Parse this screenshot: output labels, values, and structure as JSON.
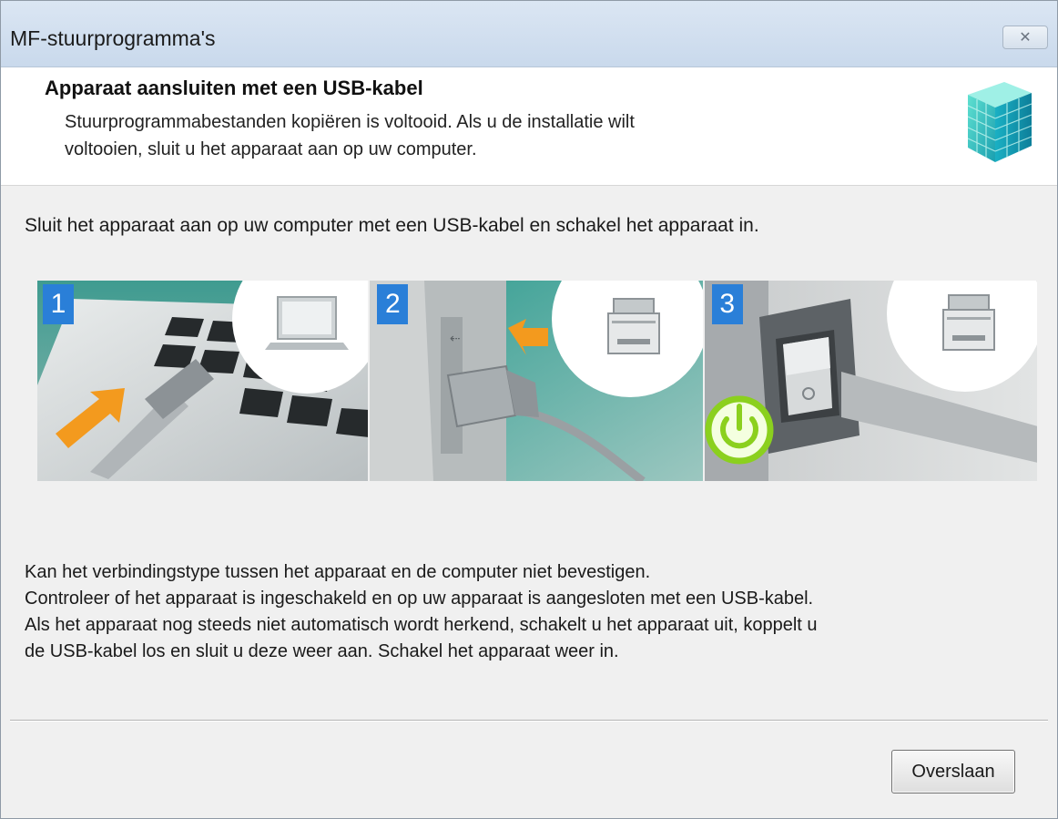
{
  "window": {
    "title": "MF-stuurprogramma's",
    "close_glyph": "✕"
  },
  "header": {
    "title": "Apparaat aansluiten met een USB-kabel",
    "description_line1": "Stuurprogrammabestanden kopiëren is voltooid. Als u de installatie wilt",
    "description_line2": "voltooien, sluit u het apparaat aan op uw computer.",
    "logo_icon": "cube-grid-icon"
  },
  "main": {
    "instruction": "Sluit het apparaat aan op uw computer met een USB-kabel en schakel het apparaat in.",
    "steps": [
      {
        "number": "1",
        "icon": "usb-laptop-icon"
      },
      {
        "number": "2",
        "icon": "usb-printer-icon"
      },
      {
        "number": "3",
        "icon": "power-switch-icon"
      }
    ],
    "message_lines": [
      "Kan het verbindingstype tussen het apparaat en de computer niet bevestigen.",
      "Controleer of het apparaat is ingeschakeld en op uw apparaat is aangesloten met een USB-kabel.",
      "Als het apparaat nog steeds niet automatisch wordt herkend, schakelt u het apparaat uit, koppelt u",
      "de USB-kabel los en sluit u deze weer aan. Schakel het apparaat weer in."
    ]
  },
  "footer": {
    "skip_label": "Overslaan"
  },
  "colors": {
    "step_badge": "#2a7fd8",
    "arrow": "#f39a1e",
    "power": "#8bd01e",
    "teal": "#3aa79a"
  }
}
